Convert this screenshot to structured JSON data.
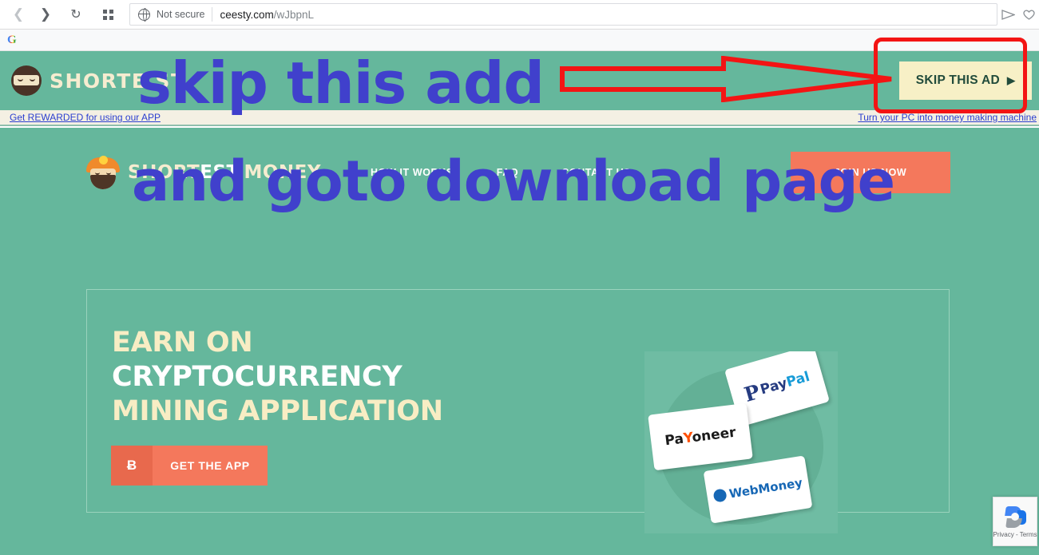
{
  "browser": {
    "back_icon": "chevron-left-icon",
    "forward_icon": "chevron-right-icon",
    "reload_icon": "reload-icon",
    "apps_icon": "grid-apps-icon",
    "security_label": "Not secure",
    "url_domain": "ceesty.com",
    "url_path": "/wJbpnL",
    "share_icon": "send-arrow-icon",
    "favorite_icon": "heart-icon"
  },
  "google_strip": {
    "logo": "G"
  },
  "ad_bar": {
    "brand": "SHORTE.ST",
    "mascot": "ninja-mascot-icon",
    "skip_button": "SKIP THIS AD",
    "skip_arrow": "▶"
  },
  "cream_bar": {
    "left_link": "Get REWARDED for using our APP",
    "right_link": "Turn your PC into money making machine"
  },
  "site": {
    "brand_part1": "SHORT",
    "brand_part2": "EST",
    "brand_part3": ".MONEY",
    "mascot": "miner-mascot-icon",
    "nav": [
      "HOW IT WORKS",
      "FAQ",
      "CONTACT US"
    ],
    "join_button": "JOIN US NOW"
  },
  "promo": {
    "line1": "EARN ON",
    "line2": "CRYPTOCURRENCY",
    "line3": "MINING APPLICATION",
    "cta_symbol": "Ƀ",
    "cta_label": "GET THE APP",
    "payment_cards": [
      {
        "name": "PayPal",
        "pay": "Pay",
        "pal": "Pal",
        "mark": "P"
      },
      {
        "name": "Payoneer",
        "pa": "Pa",
        "y": "Y",
        "oneer": "oneer"
      },
      {
        "name": "WebMoney",
        "label": "WebMoney"
      }
    ]
  },
  "recaptcha": {
    "text": "Privacy - Terms",
    "icon": "recaptcha-icon"
  },
  "annotations": {
    "line1": "skip this add",
    "line2": "and goto download page",
    "highlight_box": "red-rounded-rectangle",
    "arrow": "red-arrow-right",
    "color": "#4040cc",
    "mark_color": "#f31414"
  }
}
